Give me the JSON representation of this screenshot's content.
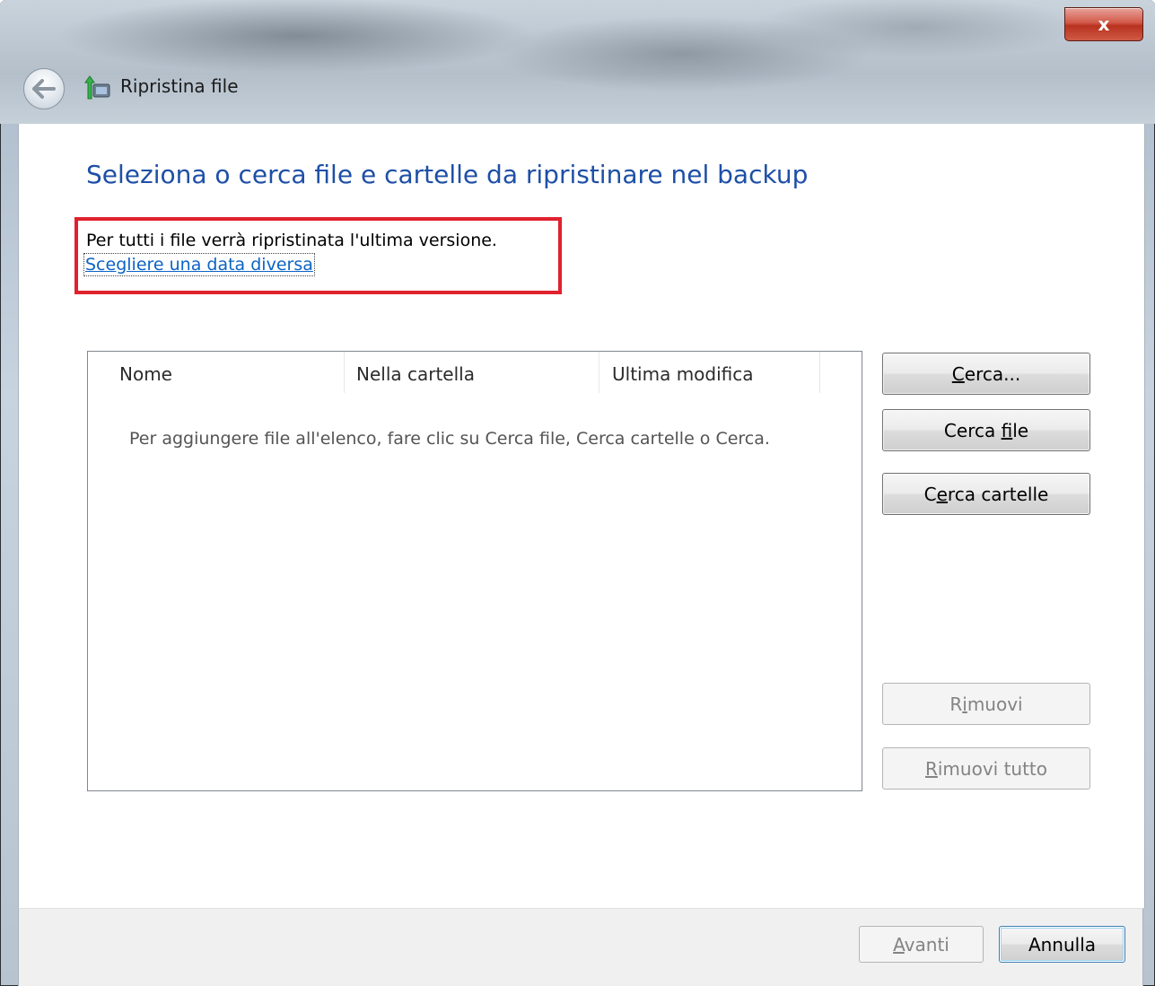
{
  "window": {
    "title": "Ripristina file",
    "close_label": "x"
  },
  "page": {
    "heading": "Seleziona o cerca file e cartelle da ripristinare nel backup",
    "info_text": "Per tutti i file verrà ripristinata l'ultima versione.",
    "link_text": "Scegliere una data diversa"
  },
  "file_list": {
    "columns": [
      "Nome",
      "Nella cartella",
      "Ultima modifica"
    ],
    "empty_message": "Per aggiungere file all'elenco, fare clic su Cerca file, Cerca cartelle o Cerca."
  },
  "buttons": {
    "search": {
      "pre": "",
      "key": "C",
      "post": "erca..."
    },
    "search_files": {
      "pre": "Cerca ",
      "key": "f",
      "post": "ile"
    },
    "search_folders": {
      "pre": "C",
      "key": "e",
      "post": "rca cartelle"
    },
    "remove": {
      "pre": "R",
      "key": "i",
      "post": "muovi"
    },
    "remove_all": {
      "pre": "",
      "key": "R",
      "post": "imuovi tutto"
    },
    "next": {
      "pre": "",
      "key": "A",
      "post": "vanti"
    },
    "cancel": "Annulla"
  },
  "icons": {
    "back": "back-arrow-icon",
    "restore": "restore-files-icon",
    "close": "close-icon"
  }
}
